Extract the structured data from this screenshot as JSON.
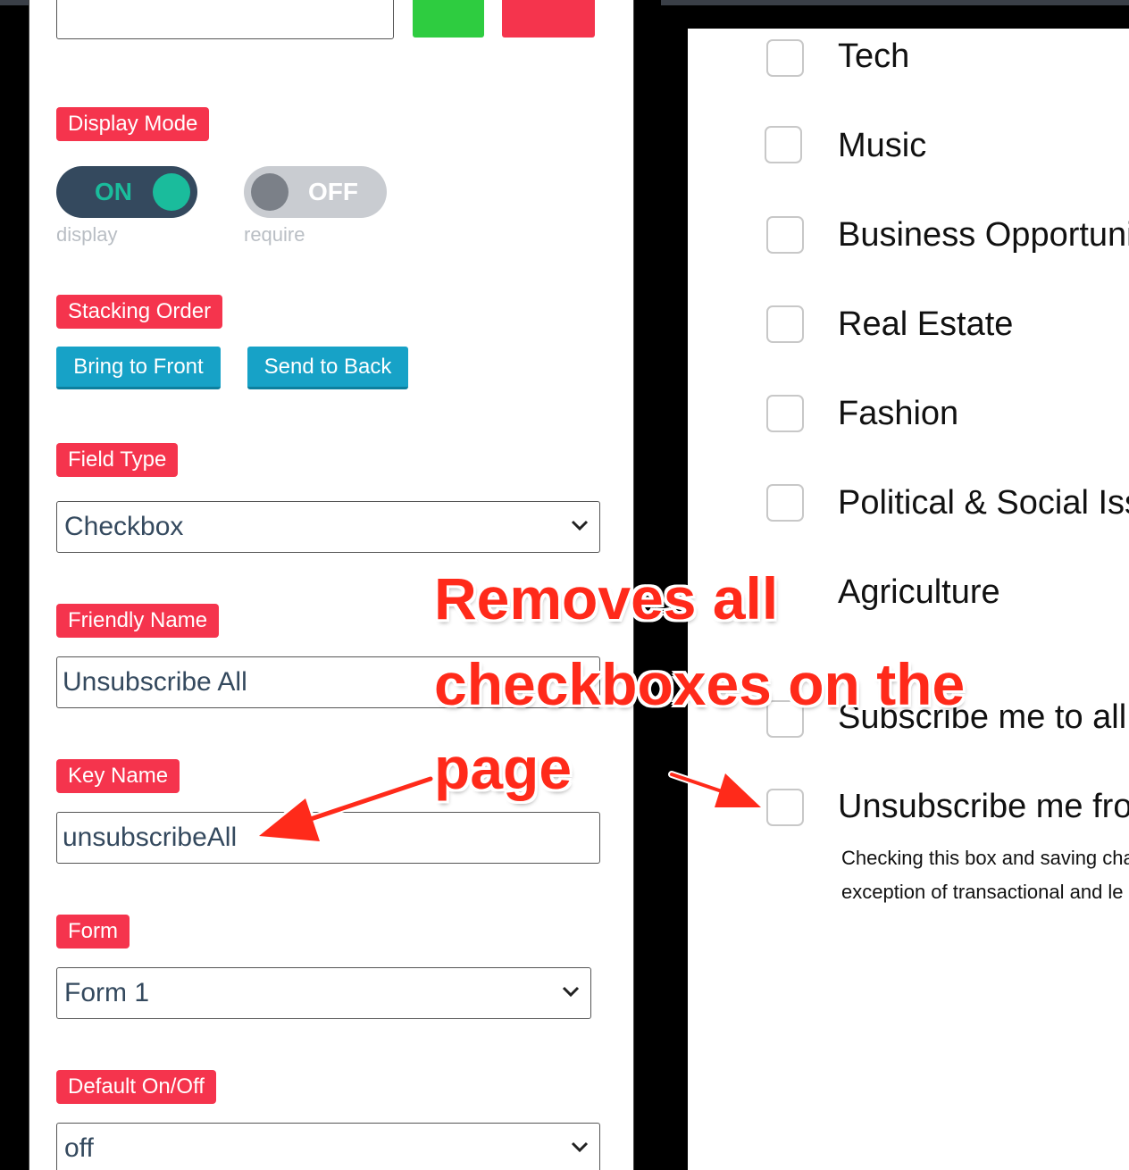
{
  "left_panel": {
    "display_mode": {
      "tag": "Display Mode",
      "toggle_on": {
        "label": "ON",
        "caption": "display"
      },
      "toggle_off": {
        "label": "OFF",
        "caption": "require"
      }
    },
    "stacking_order": {
      "tag": "Stacking Order",
      "bring_front": "Bring to Front",
      "send_back": "Send to Back"
    },
    "field_type": {
      "tag": "Field Type",
      "value": "Checkbox"
    },
    "friendly_name": {
      "tag": "Friendly Name",
      "value": "Unsubscribe All"
    },
    "key_name": {
      "tag": "Key Name",
      "value": "unsubscribeAll"
    },
    "form": {
      "tag": "Form",
      "value": "Form 1"
    },
    "default_onoff": {
      "tag": "Default On/Off",
      "value": "off"
    }
  },
  "right_panel": {
    "options": [
      {
        "label": "Tech"
      },
      {
        "label": "Music"
      },
      {
        "label": "Business Opportuni"
      },
      {
        "label": "Real Estate"
      },
      {
        "label": "Fashion"
      },
      {
        "label": "Political & Social Iss"
      },
      {
        "label": "Agriculture"
      },
      {
        "label": "Subscribe me to all"
      },
      {
        "label": "Unsubscribe me fro"
      }
    ],
    "help_line1": "Checking this box and saving cha",
    "help_line2": "exception of transactional and le"
  },
  "annotation": {
    "line1": "Removes all",
    "line2": "checkboxes on the",
    "line3": "page"
  },
  "colors": {
    "tag_red": "#f5344d",
    "button_blue": "#17a2c7",
    "toggle_on_bg": "#34495e",
    "toggle_on_knob": "#1abc9c",
    "annotation_red": "#ff2a1a"
  }
}
